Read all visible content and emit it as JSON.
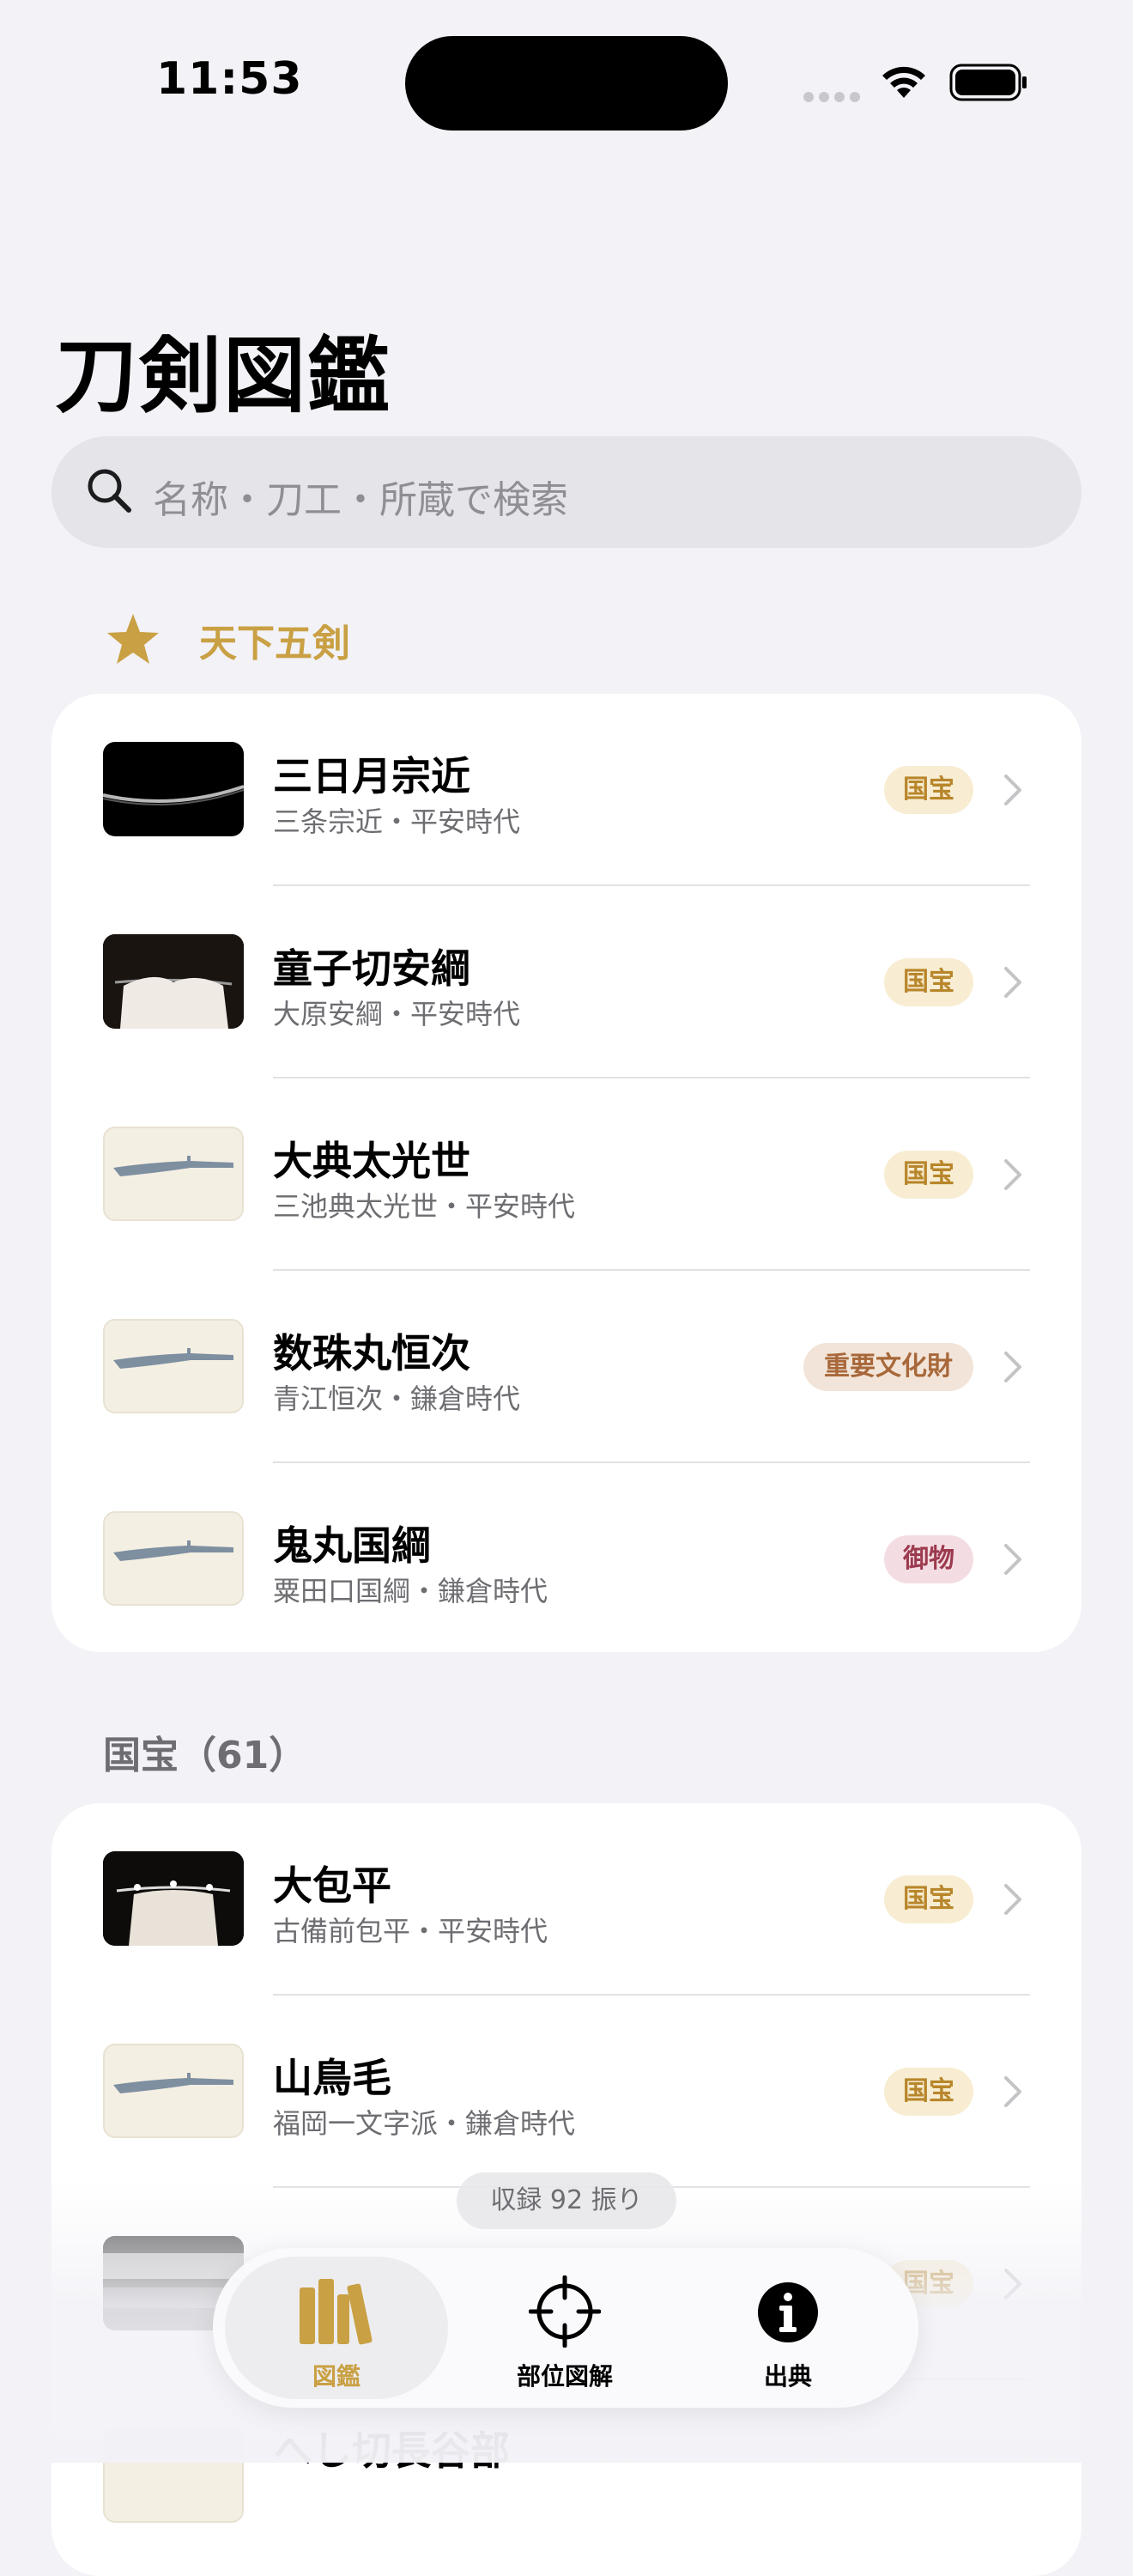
{
  "status_bar": {
    "time": "11:53"
  },
  "page_title": "刀剣図鑑",
  "search": {
    "placeholder": "名称・刀工・所蔵で検索"
  },
  "colors": {
    "gold": "#C9A043",
    "background": "#F2F2F7",
    "kokuho_badge": "#F8EDD2",
    "juyo_badge": "#F2E4D8",
    "gyobutsu_badge": "#F4DDE2"
  },
  "section_tenka": {
    "title": "天下五剣",
    "icon": "star-icon",
    "items": [
      {
        "name": "三日月宗近",
        "sub": "三条宗近・平安時代",
        "badge": "国宝",
        "thumb": "photo-dark-blade"
      },
      {
        "name": "童子切安綱",
        "sub": "大原安綱・平安時代",
        "badge": "国宝",
        "thumb": "photo-display-cloth"
      },
      {
        "name": "大典太光世",
        "sub": "三池典太光世・平安時代",
        "badge": "国宝",
        "thumb": "sword-illustration"
      },
      {
        "name": "数珠丸恒次",
        "sub": "青江恒次・鎌倉時代",
        "badge": "重要文化財",
        "thumb": "sword-illustration"
      },
      {
        "name": "鬼丸国綱",
        "sub": "粟田口国綱・鎌倉時代",
        "badge": "御物",
        "thumb": "sword-illustration"
      }
    ]
  },
  "section_kokuho": {
    "title": "国宝（61）",
    "items": [
      {
        "name": "大包平",
        "sub": "古備前包平・平安時代",
        "badge": "国宝",
        "thumb": "photo-display-cloth"
      },
      {
        "name": "山鳥毛",
        "sub": "福岡一文字派・鎌倉時代",
        "badge": "国宝",
        "thumb": "sword-illustration"
      },
      {
        "name": "",
        "sub": "",
        "badge": "国宝",
        "thumb": "photo-grayscale"
      },
      {
        "name": "へし切長谷部",
        "sub": "",
        "badge": "",
        "thumb": "sword-illustration"
      }
    ]
  },
  "footer": {
    "count_label": "収録 92 振り"
  },
  "tabbar": {
    "tabs": [
      {
        "label": "図鑑",
        "icon": "books-icon",
        "active": true
      },
      {
        "label": "部位図解",
        "icon": "crosshair-icon",
        "active": false
      },
      {
        "label": "出典",
        "icon": "info-icon",
        "active": false
      }
    ]
  }
}
